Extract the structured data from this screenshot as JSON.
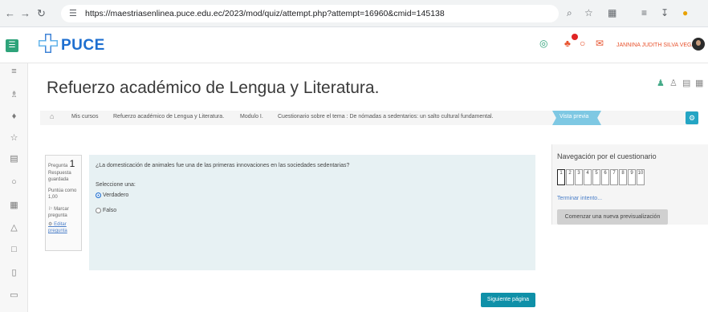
{
  "browser": {
    "url": "https://maestriasenlinea.puce.edu.ec/2023/mod/quiz/attempt.php?attempt=16960&cmid=145138",
    "icons": [
      "back-icon",
      "forward-icon",
      "reload-icon",
      "site-info-icon",
      "zoom-icon",
      "star-icon",
      "extensions-icon",
      "tab-search-icon",
      "download-icon",
      "profile-icon"
    ]
  },
  "header": {
    "logo_text": "PUCE",
    "user_name": "JANNINA JUDITH SILVA VEGA",
    "notification_count": "1",
    "colors": {
      "menu": "#2ea37a",
      "logo": "#1e6fd0",
      "user": "#e8532e",
      "badge": "#e02424"
    }
  },
  "page": {
    "title": "Refuerzo académico de Lengua y Literatura."
  },
  "breadcrumb": {
    "items": [
      "Mis cursos",
      "Refuerzo académico de Lengua y Literatura.",
      "Modulo I.",
      "Cuestionario sobre el tema : De nómadas a sedentarios: un salto cultural fundamental.",
      "Vista previa"
    ],
    "active_color": "#7ec8e3"
  },
  "question_info": {
    "label": "Pregunta",
    "number": "1",
    "status": "Respuesta guardada",
    "score": "Puntúa como 1,00",
    "flag": "Marcar pregunta",
    "edit": "Editar pregunta"
  },
  "question": {
    "text": "¿La domesticación de animales fue una de las primeras innovaciones en las sociedades sedentarias?",
    "prompt": "Seleccione una:",
    "options": [
      {
        "label": "Verdadero",
        "selected": true
      },
      {
        "label": "Falso",
        "selected": false
      }
    ],
    "background": "#e7f1f3"
  },
  "next_button": "Siguiente página",
  "quiz_nav": {
    "title": "Navegación por el cuestionario",
    "numbers": [
      "1",
      "2",
      "3",
      "4",
      "5",
      "6",
      "7",
      "8",
      "9",
      "10"
    ],
    "current": "1",
    "finish": "Terminar intento...",
    "new_preview": "Comenzar una nueva previsualización"
  }
}
